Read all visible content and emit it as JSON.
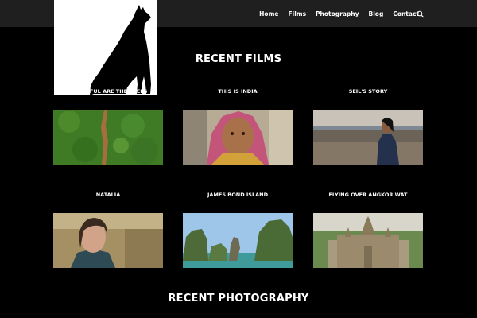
{
  "nav": {
    "items": [
      "Home",
      "Films",
      "Photography",
      "Blog",
      "Contact"
    ]
  },
  "sections": {
    "films_title": "RECENT FILMS",
    "photo_title": "RECENT PHOTOGRAPHY"
  },
  "films": [
    {
      "title": "BEAUTIFUL ARE THE TREES",
      "thumb": "forest-aerial-thumbnail"
    },
    {
      "title": "THIS IS INDIA",
      "thumb": "portrait-woman-india-thumbnail"
    },
    {
      "title": "SEIL'S STORY",
      "thumb": "beach-girl-thumbnail"
    },
    {
      "title": "NATALIA",
      "thumb": "portrait-natalia-thumbnail"
    },
    {
      "title": "JAMES BOND ISLAND",
      "thumb": "island-rocks-thumbnail"
    },
    {
      "title": "FLYING OVER ANGKOR WAT",
      "thumb": "angkor-wat-aerial-thumbnail"
    }
  ],
  "colors": {
    "background": "#000000",
    "topbar": "#1f1f1f",
    "text": "#ffffff"
  }
}
